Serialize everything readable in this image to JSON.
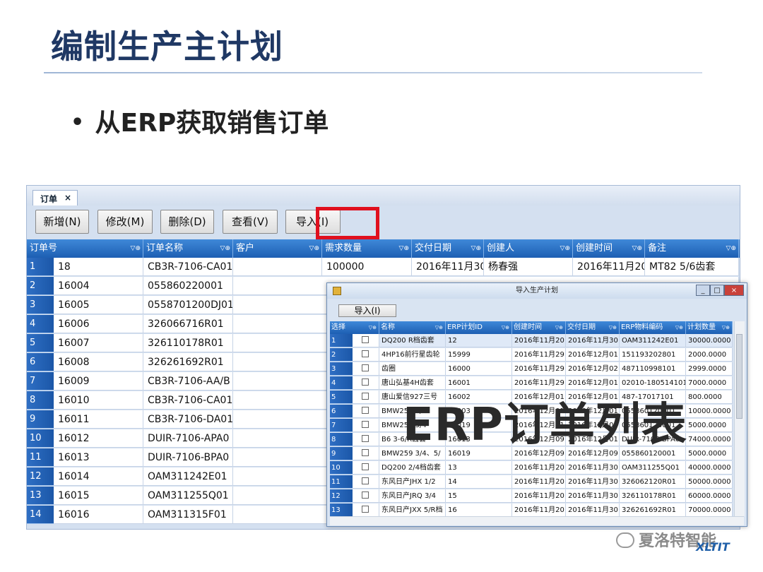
{
  "slide": {
    "title": "编制生产主计划",
    "bullet_symbol": "•",
    "bullet_text": "从ERP获取销售订单"
  },
  "main_window": {
    "tab_label": "订单",
    "tab_close": "×",
    "toolbar": {
      "add_label": "新增(N)",
      "edit_label": "修改(M)",
      "delete_label": "删除(D)",
      "view_label": "查看(V)",
      "import_label": "导入(I)"
    },
    "columns": [
      "订单号",
      "订单名称",
      "客户",
      "需求数量",
      "交付日期",
      "创建人",
      "创建时间",
      "备注"
    ],
    "filter_icon": "▽⊕",
    "rows": [
      {
        "n": "1",
        "id": "18",
        "name": "CB3R-7106-CA01",
        "customer": "",
        "qty": "100000",
        "date": "2016年11月30",
        "creator": "杨春强",
        "created": "2016年11月20",
        "note": "MT82  5/6齿套"
      },
      {
        "n": "2",
        "id": "16004",
        "name": "055860220001"
      },
      {
        "n": "3",
        "id": "16005",
        "name": "0558701200DJ01"
      },
      {
        "n": "4",
        "id": "16006",
        "name": "326066716R01"
      },
      {
        "n": "5",
        "id": "16007",
        "name": "326110178R01"
      },
      {
        "n": "6",
        "id": "16008",
        "name": "326261692R01"
      },
      {
        "n": "7",
        "id": "16009",
        "name": "CB3R-7106-AA/B"
      },
      {
        "n": "8",
        "id": "16010",
        "name": "CB3R-7106-CA01"
      },
      {
        "n": "9",
        "id": "16011",
        "name": "CB3R-7106-DA01"
      },
      {
        "n": "10",
        "id": "16012",
        "name": "DUIR-7106-APA0"
      },
      {
        "n": "11",
        "id": "16013",
        "name": "DUIR-7106-BPA0"
      },
      {
        "n": "12",
        "id": "16014",
        "name": "OAM311242E01"
      },
      {
        "n": "13",
        "id": "16015",
        "name": "OAM311255Q01"
      },
      {
        "n": "14",
        "id": "16016",
        "name": "OAM311315F01"
      }
    ]
  },
  "popup": {
    "title": "导入生产计划",
    "minimize": "_",
    "maximize": "□",
    "close": "×",
    "import_label": "导入(I)",
    "columns": [
      "选择",
      "名称",
      "ERP计划ID",
      "创建时间",
      "交付日期",
      "ERP物料编码",
      "计划数量"
    ],
    "filter_icon": "▽⊕",
    "rows": [
      {
        "n": "1",
        "name": "DQ200   R档齿套",
        "erp_id": "12",
        "created": "2016年11月20",
        "due": "2016年11月30",
        "code": "OAM311242E01",
        "qty": "30000.0000"
      },
      {
        "n": "2",
        "name": "4HP16前行星齿轮",
        "erp_id": "15999",
        "created": "2016年11月29",
        "due": "2016年12月01",
        "code": "151193202801",
        "qty": "2000.0000"
      },
      {
        "n": "3",
        "name": "齿圈",
        "erp_id": "16000",
        "created": "2016年11月29",
        "due": "2016年12月02",
        "code": "487110998101",
        "qty": "2999.0000"
      },
      {
        "n": "4",
        "name": "唐山弘基4H齿套",
        "erp_id": "16001",
        "created": "2016年11月29",
        "due": "2016年12月01",
        "code": "02010-180514101",
        "qty": "7000.0000"
      },
      {
        "n": "5",
        "name": "唐山爱信927三号",
        "erp_id": "16002",
        "created": "2016年12月01",
        "due": "2016年12月01",
        "code": "487-17017101",
        "qty": "800.0000"
      },
      {
        "n": "6",
        "name": "BMW259 3/4",
        "erp_id": "16003",
        "created": "2016年12月01",
        "due": "2016年12月01",
        "code": "055860120001",
        "qty": "10000.0000"
      },
      {
        "n": "7",
        "name": "BMW259 3/4",
        "erp_id": "16019",
        "created": "2016年12月01",
        "due": "2016年12月01",
        "code": "055860120001",
        "qty": "5000.0000"
      },
      {
        "n": "8",
        "name": "B6  3-6/R齿套",
        "erp_id": "16013",
        "created": "2016年12月09",
        "due": "2016年12月01",
        "code": "DUIR-7106-BPA0",
        "qty": "74000.0000"
      },
      {
        "n": "9",
        "name": "BMW259 3/4、5/",
        "erp_id": "16019",
        "created": "2016年12月09",
        "due": "2016年12月09",
        "code": "055860120001",
        "qty": "5000.0000"
      },
      {
        "n": "10",
        "name": "DQ200  2/4档齿套",
        "erp_id": "13",
        "created": "2016年11月20",
        "due": "2016年11月30",
        "code": "OAM311255Q01",
        "qty": "40000.0000"
      },
      {
        "n": "11",
        "name": "东风日产JHX 1/2",
        "erp_id": "14",
        "created": "2016年11月20",
        "due": "2016年11月30",
        "code": "326062120R01",
        "qty": "50000.0000"
      },
      {
        "n": "12",
        "name": "东风日产JRQ 3/4",
        "erp_id": "15",
        "created": "2016年11月20",
        "due": "2016年11月30",
        "code": "326110178R01",
        "qty": "60000.0000"
      },
      {
        "n": "13",
        "name": "东风日产JXX 5/R档",
        "erp_id": "16",
        "created": "2016年11月20",
        "due": "2016年11月30",
        "code": "326261692R01",
        "qty": "70000.0000"
      }
    ]
  },
  "overlay_text": "ERP订单列表",
  "watermark": {
    "text": "夏洛特智能",
    "logo": "XLTIT"
  },
  "colors": {
    "header_blue": "#1d5fb3",
    "title_navy": "#1f3864",
    "highlight_red": "#e0101e"
  }
}
